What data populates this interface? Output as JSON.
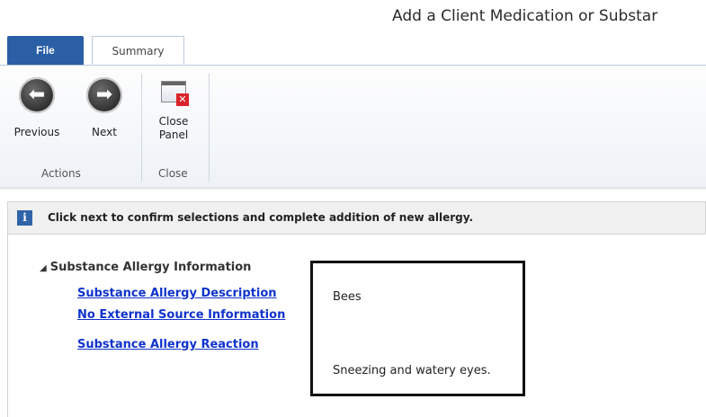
{
  "window": {
    "title": "Add a Client Medication or Substar"
  },
  "tabs": [
    {
      "label": "File",
      "active": false
    },
    {
      "label": "Summary",
      "active": true
    }
  ],
  "ribbon": {
    "groups": [
      {
        "label": "Actions",
        "buttons": [
          {
            "label": "Previous",
            "icon": "arrow-left-icon"
          },
          {
            "label": "Next",
            "icon": "arrow-right-icon"
          }
        ]
      },
      {
        "label": "Close",
        "buttons": [
          {
            "label_line1": "Close",
            "label_line2": "Panel",
            "icon": "close-panel-icon"
          }
        ]
      }
    ]
  },
  "info_bar": {
    "icon": "info-icon",
    "text": "Click next to confirm selections and complete addition of new allergy."
  },
  "tree": {
    "section_title": "Substance Allergy Information",
    "items": [
      {
        "label": "Substance Allergy Description",
        "value": "Bees"
      },
      {
        "label": "No External Source Information",
        "value": ""
      },
      {
        "label": "Substance Allergy Reaction",
        "value": "Sneezing and watery eyes."
      }
    ]
  },
  "colors": {
    "file_tab": "#2a5fa6",
    "link": "#1033cc",
    "close_badge": "#d9242b",
    "info_icon": "#2f64a8"
  }
}
